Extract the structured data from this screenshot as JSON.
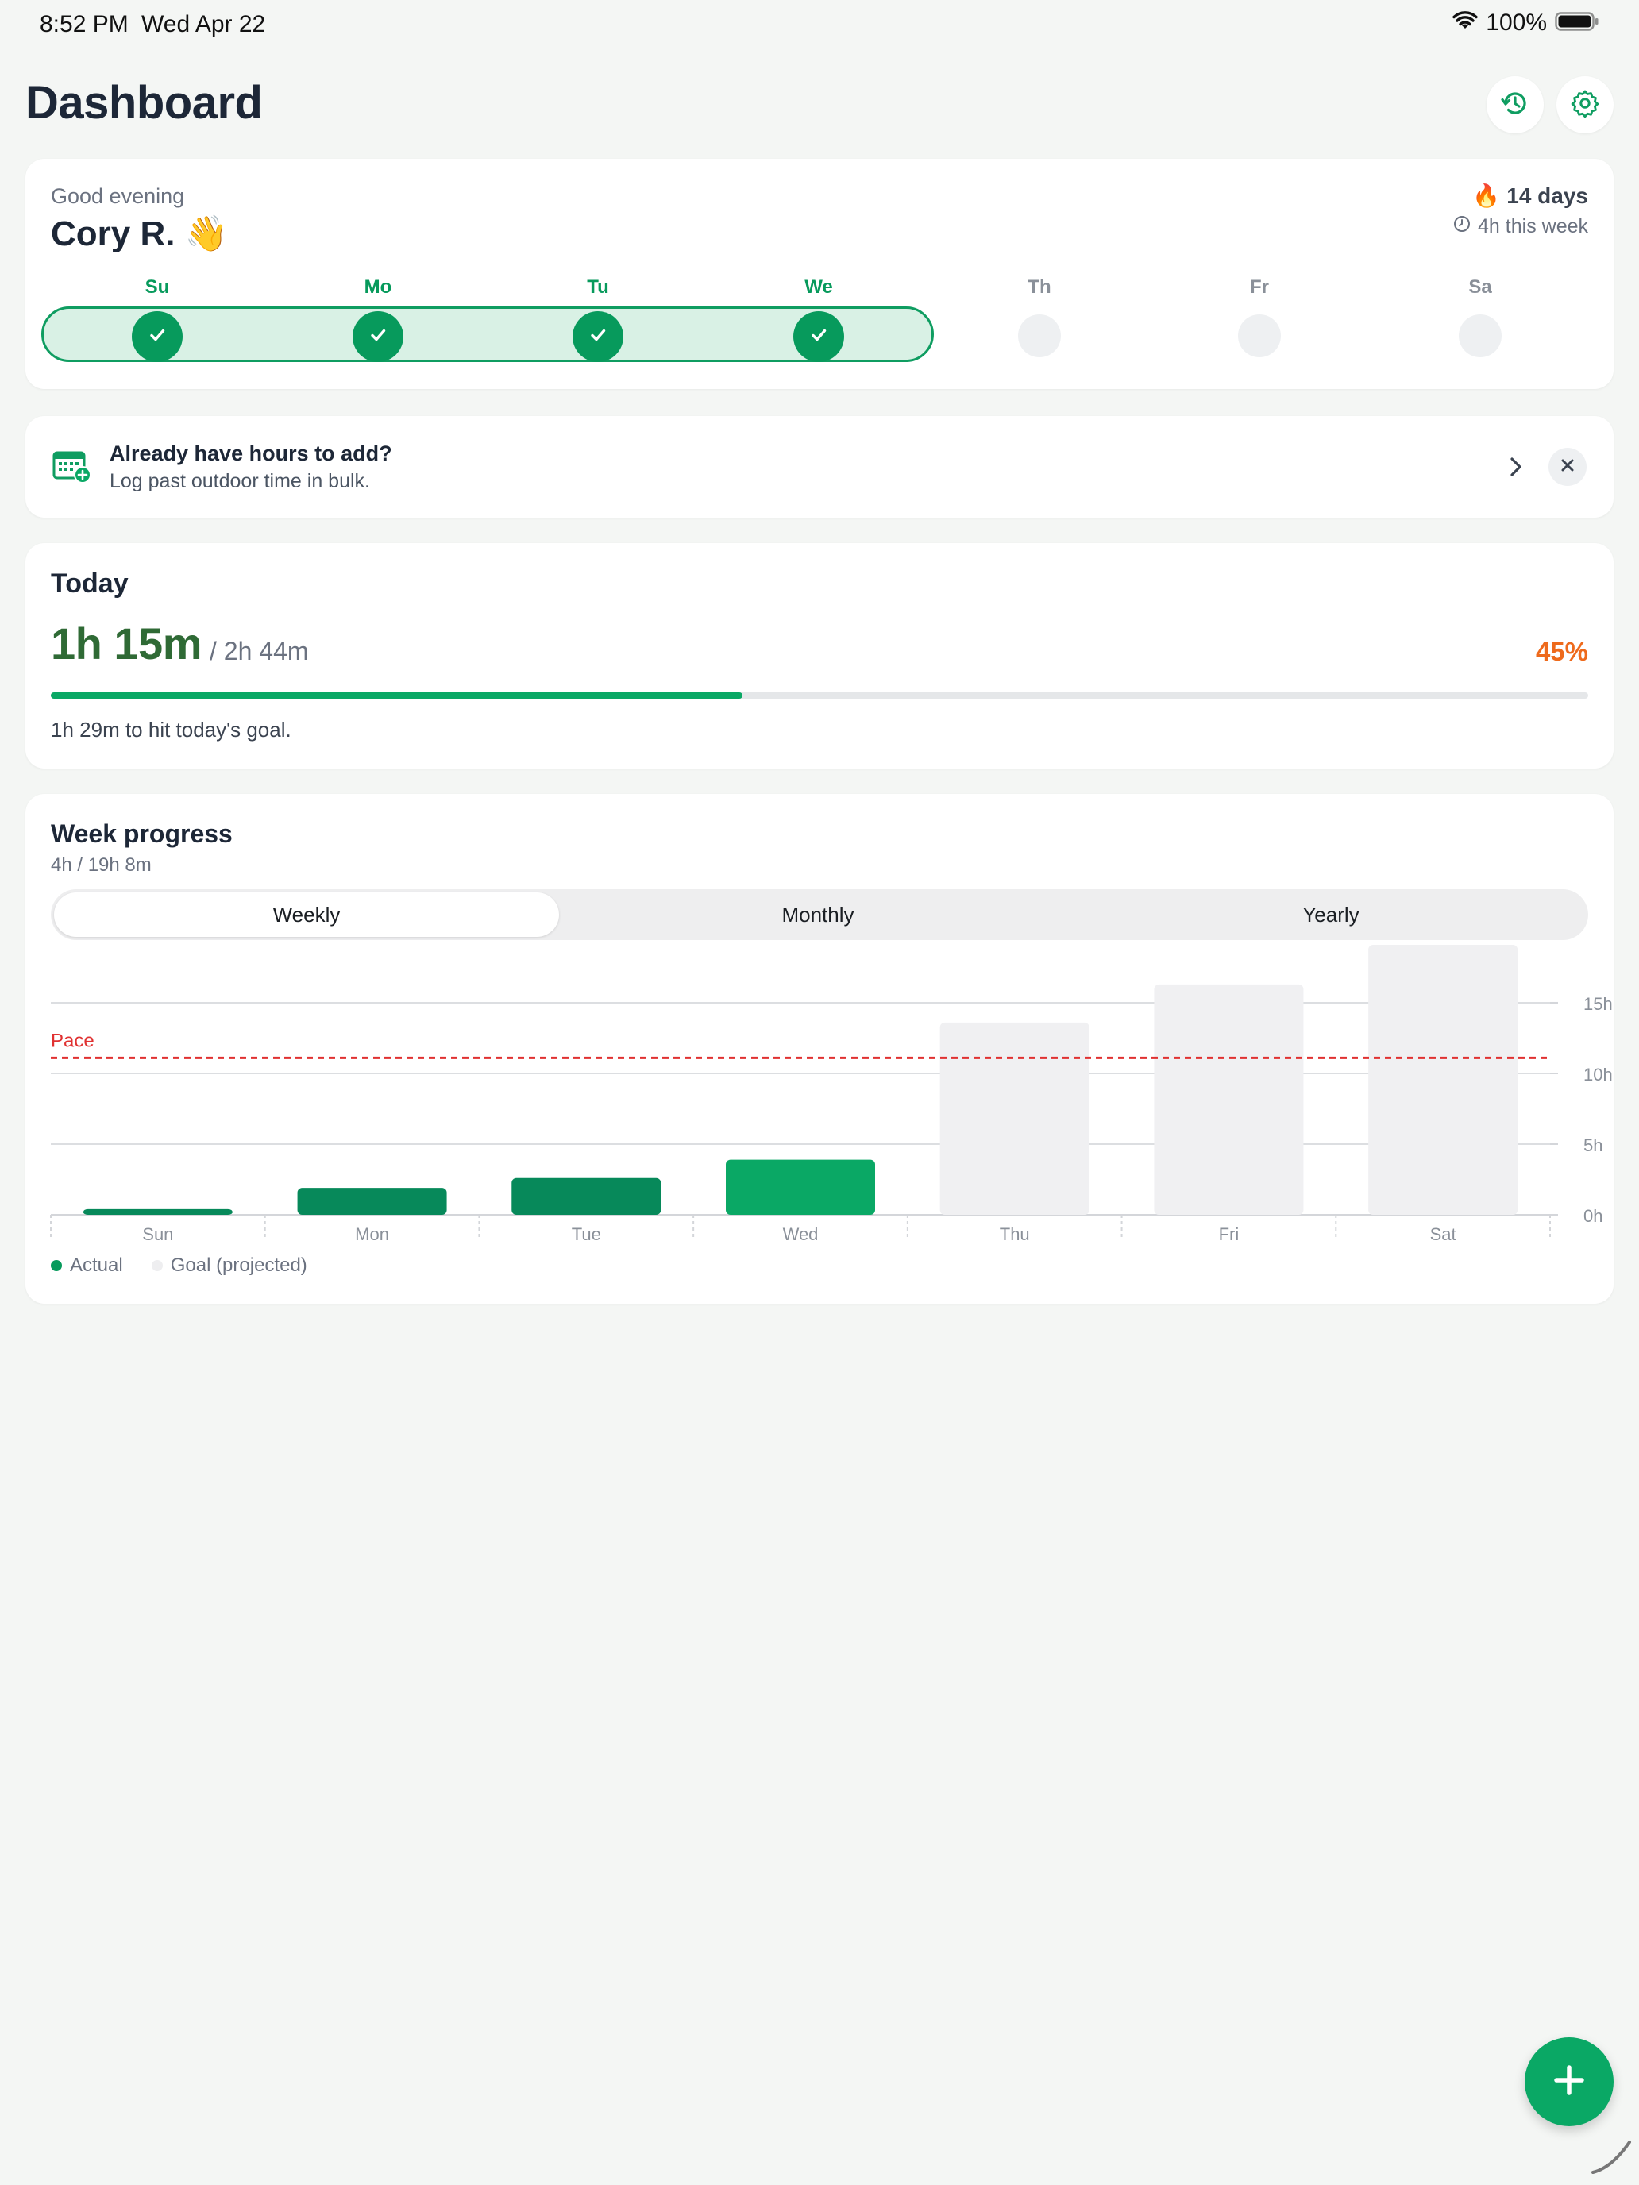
{
  "status_bar": {
    "time": "8:52 PM",
    "date": "Wed Apr 22",
    "battery": "100%"
  },
  "header": {
    "title": "Dashboard",
    "history_icon": "history-icon",
    "settings_icon": "gear-icon"
  },
  "greeting": {
    "subtitle": "Good evening",
    "name": "Cory R. 👋",
    "streak": "14 days",
    "streak_icon": "🔥",
    "week_hours": "4h this week",
    "days": [
      {
        "label": "Su",
        "done": true
      },
      {
        "label": "Mo",
        "done": true
      },
      {
        "label": "Tu",
        "done": true
      },
      {
        "label": "We",
        "done": true
      },
      {
        "label": "Th",
        "done": false
      },
      {
        "label": "Fr",
        "done": false
      },
      {
        "label": "Sa",
        "done": false
      }
    ]
  },
  "log_past": {
    "title": "Already have hours to add?",
    "subtitle": "Log past outdoor time in bulk."
  },
  "today": {
    "title": "Today",
    "value": "1h 15m",
    "goal": "/ 2h 44m",
    "percent_label": "45%",
    "progress": 0.45,
    "note": "1h 29m to hit today's goal."
  },
  "week_progress": {
    "title": "Week progress",
    "subtitle": "4h / 19h 8m",
    "tabs": [
      "Weekly",
      "Monthly",
      "Yearly"
    ],
    "active_tab": "Weekly",
    "legend": {
      "actual": "Actual",
      "goal": "Goal (projected)"
    }
  },
  "colors": {
    "accent": "#0aa865",
    "pace": "#e03131",
    "goal_bar": "#f0f0f2",
    "percent": "#ee6a1c"
  },
  "chart_data": {
    "type": "bar",
    "categories": [
      "Sun",
      "Mon",
      "Tue",
      "Wed",
      "Thu",
      "Fri",
      "Sat"
    ],
    "series": [
      {
        "name": "Actual",
        "values": [
          0.4,
          1.9,
          2.6,
          3.9,
          null,
          null,
          null
        ],
        "colors": [
          "#07895a",
          "#07895a",
          "#07895a",
          "#0aa865"
        ]
      },
      {
        "name": "Goal (projected)",
        "values": [
          null,
          null,
          null,
          null,
          13.6,
          16.3,
          19.1
        ]
      }
    ],
    "pace": {
      "label": "Pace",
      "value": 11.1
    },
    "y_ticks": [
      "0h",
      "5h",
      "10h",
      "15h"
    ],
    "y_tick_values": [
      0,
      5,
      10,
      15
    ],
    "ylim": [
      0,
      19.1
    ]
  },
  "fab": {
    "icon": "plus-icon"
  }
}
